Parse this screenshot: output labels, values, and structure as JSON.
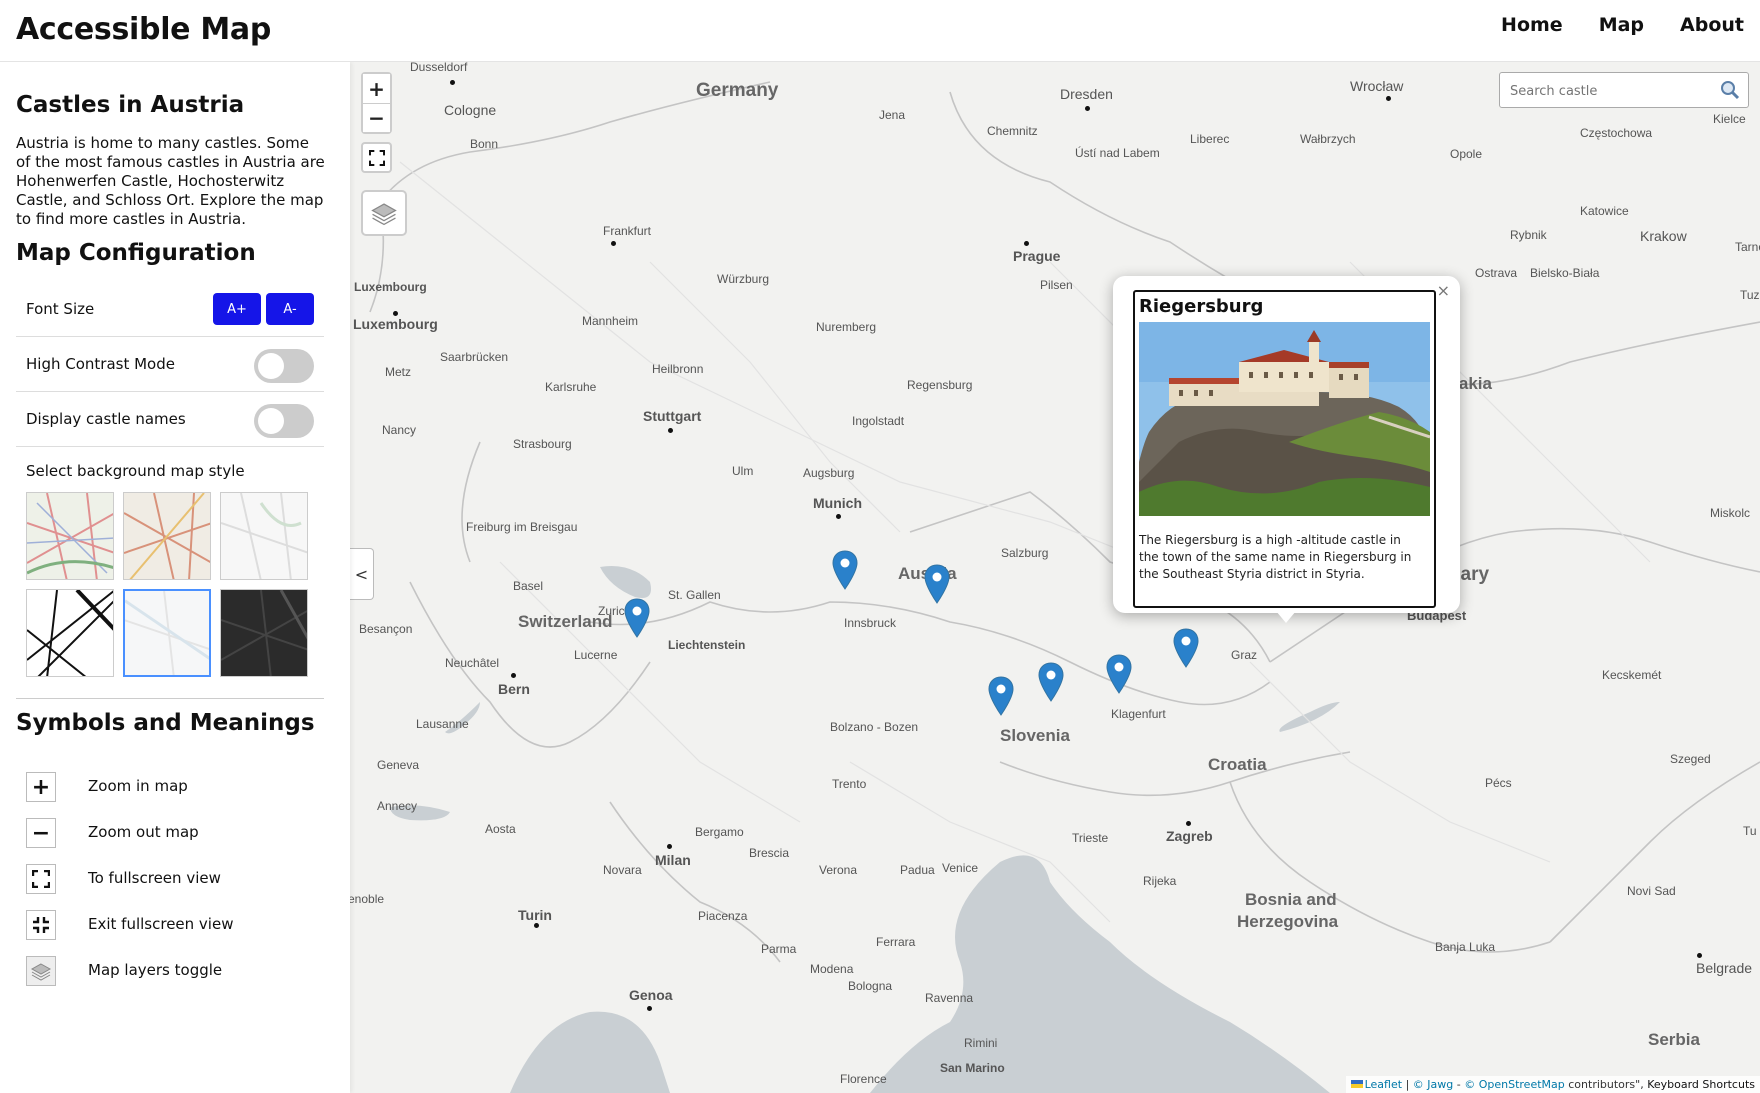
{
  "header": {
    "brand": "Accessible Map",
    "nav": [
      "Home",
      "Map",
      "About"
    ]
  },
  "sidebar": {
    "title": "Castles in Austria",
    "intro": "Austria is home to many castles. Some of the most famous castles in Austria are Hohenwerfen Castle, Hochosterwitz Castle, and Schloss Ort. Explore the map to find more castles in Austria.",
    "config_title": "Map Configuration",
    "font_size_label": "Font Size",
    "font_plus": "A+",
    "font_minus": "A-",
    "high_contrast_label": "High Contrast Mode",
    "castle_names_label": "Display castle names",
    "style_label": "Select background map style",
    "symbols_title": "Symbols and Meanings",
    "symbols": [
      {
        "icon": "zoom-in-icon",
        "label": "Zoom in map"
      },
      {
        "icon": "zoom-out-icon",
        "label": "Zoom out map"
      },
      {
        "icon": "fullscreen-icon",
        "label": "To fullscreen view"
      },
      {
        "icon": "exit-fullscreen-icon",
        "label": "Exit fullscreen view"
      },
      {
        "icon": "layers-icon",
        "label": "Map layers toggle"
      }
    ]
  },
  "map": {
    "zoom_in": "+",
    "zoom_out": "−",
    "collapse": "<",
    "search_placeholder": "Search castle",
    "countries": [
      "Germany",
      "Austria",
      "Switzerland",
      "Slovakia",
      "Hungary",
      "Slovenia",
      "Croatia",
      "Bosnia and",
      "Herzegovina",
      "Serbia"
    ],
    "capitals": [
      "Prague",
      "Luxembourg",
      "Bern",
      "Budapest",
      "Zagreb",
      "Munich",
      "Stuttgart",
      "Milan",
      "Liechtenstein",
      "Genoa",
      "Turin",
      "Luxembourg"
    ],
    "cities": [
      "Dusseldorf",
      "Cologne",
      "Bonn",
      "Frankfurt",
      "Würzburg",
      "Mannheim",
      "Heilbronn",
      "Karlsruhe",
      "Saarbrücken",
      "Metz",
      "Nancy",
      "Strasbourg",
      "Freiburg im Breisgau",
      "Basel",
      "Zurich",
      "Lucerne",
      "Neuchâtel",
      "Besançon",
      "Lausanne",
      "Geneva",
      "Annecy",
      "Aosta",
      "Nuremberg",
      "Regensburg",
      "Ingolstadt",
      "Augsburg",
      "Ulm",
      "Innsbruck",
      "Salzburg",
      "Bolzano - Bozen",
      "Trento",
      "Bergamo",
      "Brescia",
      "Verona",
      "Padua",
      "Venice",
      "Novara",
      "Piacenza",
      "Parma",
      "Modena",
      "Bologna",
      "Ravenna",
      "Ferrara",
      "Rimini",
      "San Marino",
      "Florence",
      "Dresden",
      "Jena",
      "Chemnitz",
      "Ústí nad Labem",
      "Liberec",
      "Wałbrzych",
      "Wrocław",
      "Opole",
      "Częstochowa",
      "Kielce",
      "Katowice",
      "Rybnik",
      "Krakow",
      "Ostrava",
      "Bielsko-Biała",
      "Tarnów",
      "Pilsen",
      "Miskolc",
      "Kecskemét",
      "Szeged",
      "Pécs",
      "Novi Sad",
      "Belgrade",
      "Banja Luka",
      "Rijeka",
      "Trieste",
      "Graz",
      "Klagenfurt",
      "St. Gallen",
      "Tuzla",
      "enoble",
      "Tu"
    ],
    "popup": {
      "close": "×",
      "title": "Riegersburg",
      "description": "The Riegersburg is a high -altitude castle in the town of the same name in Riegersburg in the Southeast Styria district in Styria."
    },
    "attribution": {
      "leaflet": "Leaflet",
      "sep": "|",
      "jawg": "© Jawg",
      "dash": "-",
      "osm": "© OpenStreetMap",
      "contrib": "contributors\",",
      "shortcuts": "Keyboard Shortcuts"
    }
  },
  "colors": {
    "accent": "#1515e8",
    "marker": "#2a81cb",
    "map_bg": "#f2f2f0",
    "water": "#c9cfd3"
  }
}
